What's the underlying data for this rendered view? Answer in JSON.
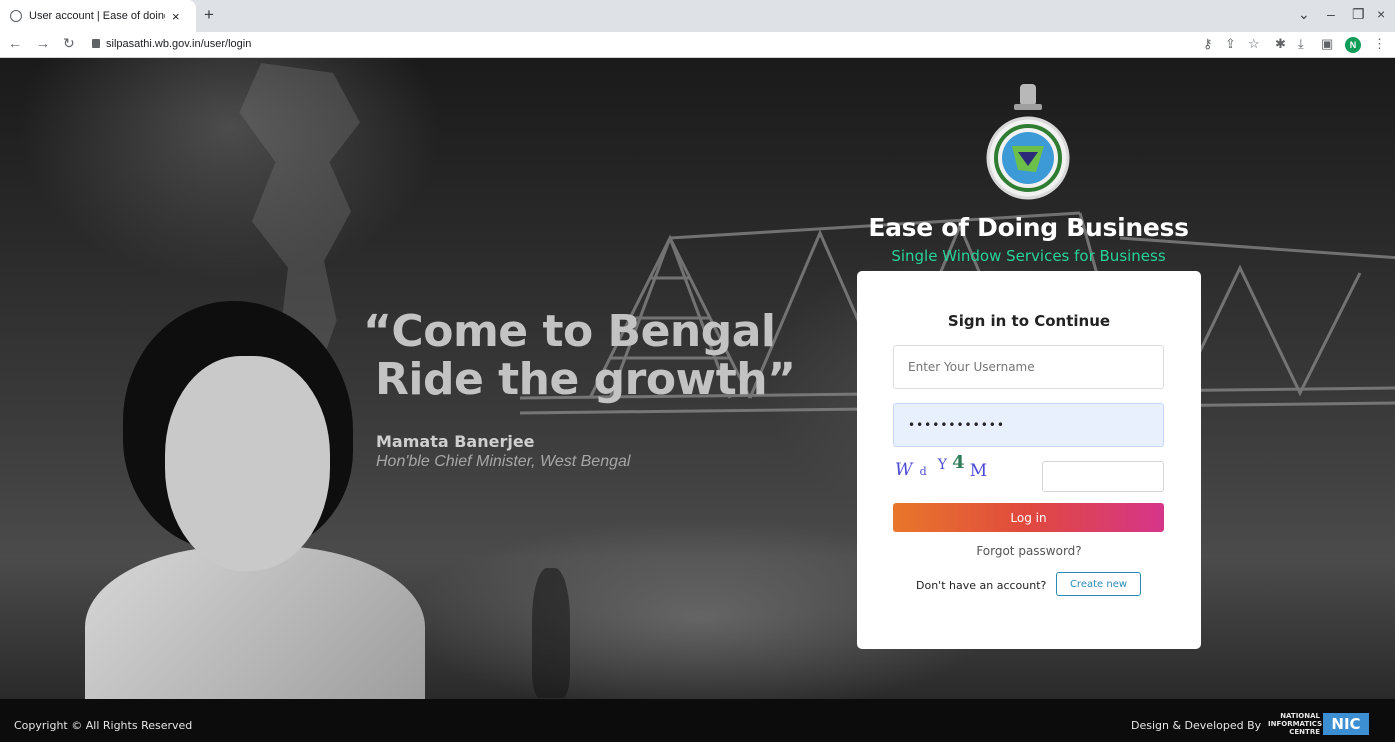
{
  "browser": {
    "tab_title": "User account | Ease of doing bus",
    "tab_close": "×",
    "new_tab": "+",
    "url": "silpasathi.wb.gov.in/user/login",
    "profile_initial": "N",
    "window_controls": [
      "⌄",
      "–",
      "❐",
      "×"
    ]
  },
  "hero": {
    "quote_line1": "“Come to Bengal",
    "quote_line2": "Ride the growth”",
    "author": "Mamata Banerjee",
    "author_role": "Hon'ble Chief Minister, West Bengal"
  },
  "brand": {
    "title": "Ease of Doing Business",
    "subtitle": "Single Window Services for Business",
    "subtitle_color": "#27d39a"
  },
  "login": {
    "title": "Sign in to Continue",
    "username_placeholder": "Enter Your Username",
    "password_value": "••••••••••••",
    "captcha_chars": [
      "W",
      "d",
      "Y",
      "4",
      "M"
    ],
    "login_label": "Log in",
    "forgot_label": "Forgot password?",
    "no_account_text": "Don't have an account?",
    "create_label": "Create new"
  },
  "footer": {
    "copyright": "Copyright © All Rights Reserved",
    "designed_by": "Design & Developed By",
    "nic_text": "NATIONAL INFORMATICS CENTRE",
    "nic_logo": "NIC"
  }
}
